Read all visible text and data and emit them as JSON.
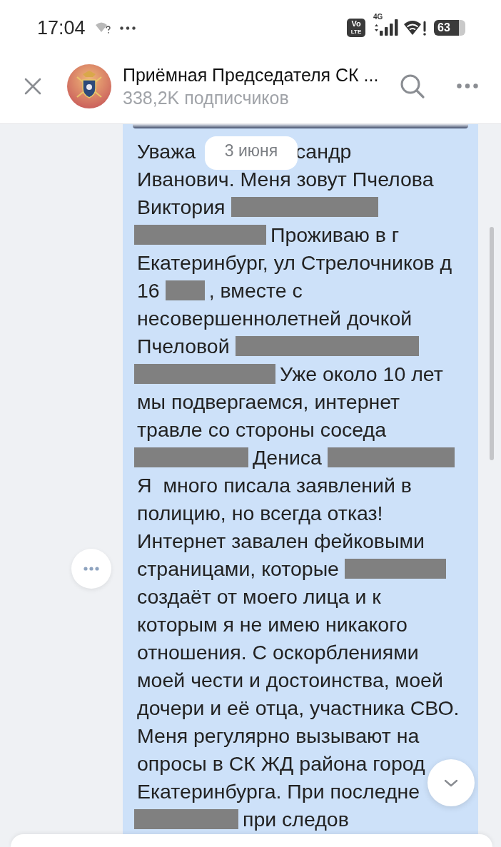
{
  "status_bar": {
    "time": "17:04",
    "network_badge": {
      "top": "Vo",
      "bottom": "LTE"
    },
    "network_type": "4G",
    "battery": "63"
  },
  "header": {
    "title": "Приёмная Председателя СК ...",
    "subtitle": "338,2K подписчиков"
  },
  "message": {
    "date": "3 июня",
    "lines": [
      [
        {
          "kind": "text",
          "text": "Уважа"
        },
        {
          "kind": "text",
          "text": "сандр"
        }
      ],
      [
        {
          "kind": "text",
          "text": "Иванович. Меня зовут Пчелова"
        }
      ],
      [
        {
          "kind": "text",
          "text": "Виктория"
        },
        {
          "kind": "redacted"
        }
      ],
      [
        {
          "kind": "redacted"
        },
        {
          "kind": "text",
          "text": "Проживаю в г"
        }
      ],
      [
        {
          "kind": "text",
          "text": "Екатеринбург, ул Стрелочников д"
        }
      ],
      [
        {
          "kind": "text",
          "text": "16"
        },
        {
          "kind": "redacted"
        },
        {
          "kind": "text",
          "text": ", вместе с"
        }
      ],
      [
        {
          "kind": "text",
          "text": "несовершеннолетней дочкой"
        }
      ],
      [
        {
          "kind": "text",
          "text": "Пчеловой"
        },
        {
          "kind": "redacted"
        }
      ],
      [
        {
          "kind": "redacted"
        },
        {
          "kind": "text",
          "text": "Уже около 10 лет"
        }
      ],
      [
        {
          "kind": "text",
          "text": "мы подвергаемся, интернет"
        }
      ],
      [
        {
          "kind": "text",
          "text": "травле со стороны соседа"
        }
      ],
      [
        {
          "kind": "redacted"
        },
        {
          "kind": "text",
          "text": "Дениса"
        },
        {
          "kind": "redacted"
        }
      ],
      [
        {
          "kind": "text",
          "text": "Я  много писала заявлений в"
        }
      ],
      [
        {
          "kind": "text",
          "text": "полицию, но всегда отказ!"
        }
      ],
      [
        {
          "kind": "text",
          "text": "Интернет завален фейковыми"
        }
      ],
      [
        {
          "kind": "text",
          "text": "страницами, которые"
        },
        {
          "kind": "redacted"
        }
      ],
      [
        {
          "kind": "text",
          "text": "создаёт от моего лица и к"
        }
      ],
      [
        {
          "kind": "text",
          "text": "которым я не имею никакого"
        }
      ],
      [
        {
          "kind": "text",
          "text": "отношения. С оскорблениями"
        }
      ],
      [
        {
          "kind": "text",
          "text": "моей чести и достоинства, моей"
        }
      ],
      [
        {
          "kind": "text",
          "text": "дочери и её отца, участника СВО."
        }
      ],
      [
        {
          "kind": "text",
          "text": "Меня регулярно вызывают на"
        }
      ],
      [
        {
          "kind": "text",
          "text": "опросы в СК ЖД района город"
        }
      ],
      [
        {
          "kind": "text",
          "text": "Екатеринбурга. При последне"
        }
      ],
      [
        {
          "kind": "redacted"
        },
        {
          "kind": "text",
          "text": "при следов"
        }
      ]
    ]
  }
}
